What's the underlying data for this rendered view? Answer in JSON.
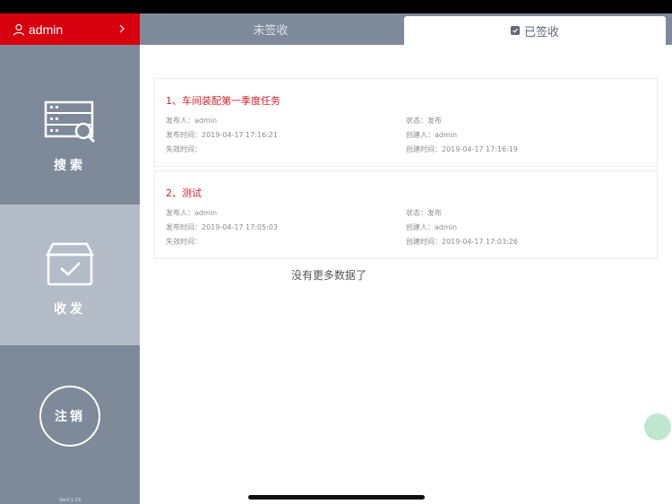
{
  "user": {
    "name": "admin"
  },
  "sidebar": {
    "search_label": "搜索",
    "inbox_label": "收发",
    "logout_label": "注销",
    "version": "Ver0.1.29"
  },
  "tabs": [
    {
      "label": "未签收"
    },
    {
      "label": "已签收"
    }
  ],
  "field_labels": {
    "publisher": "发布人：",
    "publish_time": "发布时间：",
    "expire_time": "失效时间：",
    "status": "状态：",
    "creator": "创建人：",
    "create_time": "创建时间："
  },
  "items": [
    {
      "title": "1、车间装配第一季度任务",
      "publisher": "admin",
      "publish_time": "2019-04-17 17:16:21",
      "expire_time": "",
      "status": "发布",
      "creator": "admin",
      "create_time": "2019-04-17 17:16:19"
    },
    {
      "title": "2、测试",
      "publisher": "admin",
      "publish_time": "2019-04-17 17:05:03",
      "expire_time": "",
      "status": "发布",
      "creator": "admin",
      "create_time": "2019-04-17 17:03:26"
    }
  ],
  "empty_note": "没有更多数据了",
  "colors": {
    "accent_red": "#d6000f",
    "sidebar": "#7e8a9a",
    "sidebar_active": "#b4bcc7",
    "float_button": "#bfe7cf"
  }
}
